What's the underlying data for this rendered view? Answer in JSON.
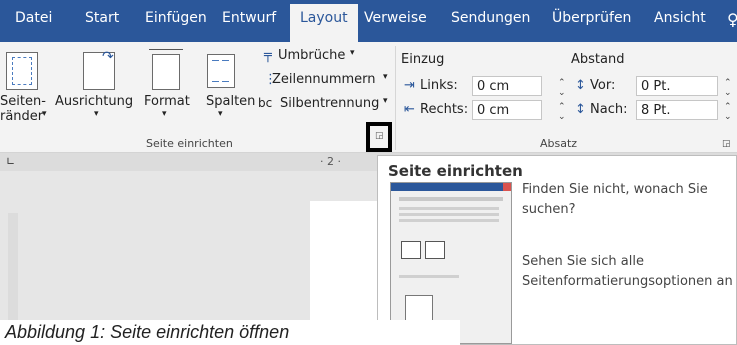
{
  "tabs": [
    "Datei",
    "Start",
    "Einfügen",
    "Entwurf",
    "Layout",
    "Verweise",
    "Sendungen",
    "Überprüfen",
    "Ansicht"
  ],
  "active_tab": "Layout",
  "ribbon": {
    "page_setup": {
      "group_label": "Seite einrichten",
      "seitenraender": [
        "Seiten-",
        "ränder"
      ],
      "ausrichtung": "Ausrichtung",
      "format": "Format",
      "spalten": "Spalten",
      "umbrueche": "Umbrüche",
      "zeilennummern": "Zeilennummern",
      "silbentrennung": "Silbentrennung"
    },
    "paragraph": {
      "group_label": "Absatz",
      "einzug_label": "Einzug",
      "abstand_label": "Abstand",
      "links_label": "Links:",
      "links_value": "0 cm",
      "rechts_label": "Rechts:",
      "rechts_value": "0 cm",
      "vor_label": "Vor:",
      "vor_value": "0 Pt.",
      "nach_label": "Nach:",
      "nach_value": "8 Pt."
    }
  },
  "ruler_text": "· 2 ·",
  "tooltip": {
    "title": "Seite einrichten",
    "line1": "Finden Sie nicht, wonach Sie",
    "line2": "suchen?",
    "line3": "Sehen Sie sich alle",
    "line4": "Seitenformatierungsoptionen an"
  },
  "caption": "Abbildung 1: Seite einrichten öffnen",
  "colors": {
    "ribbon_blue": "#2b579a",
    "highlight_box": "#000000"
  }
}
